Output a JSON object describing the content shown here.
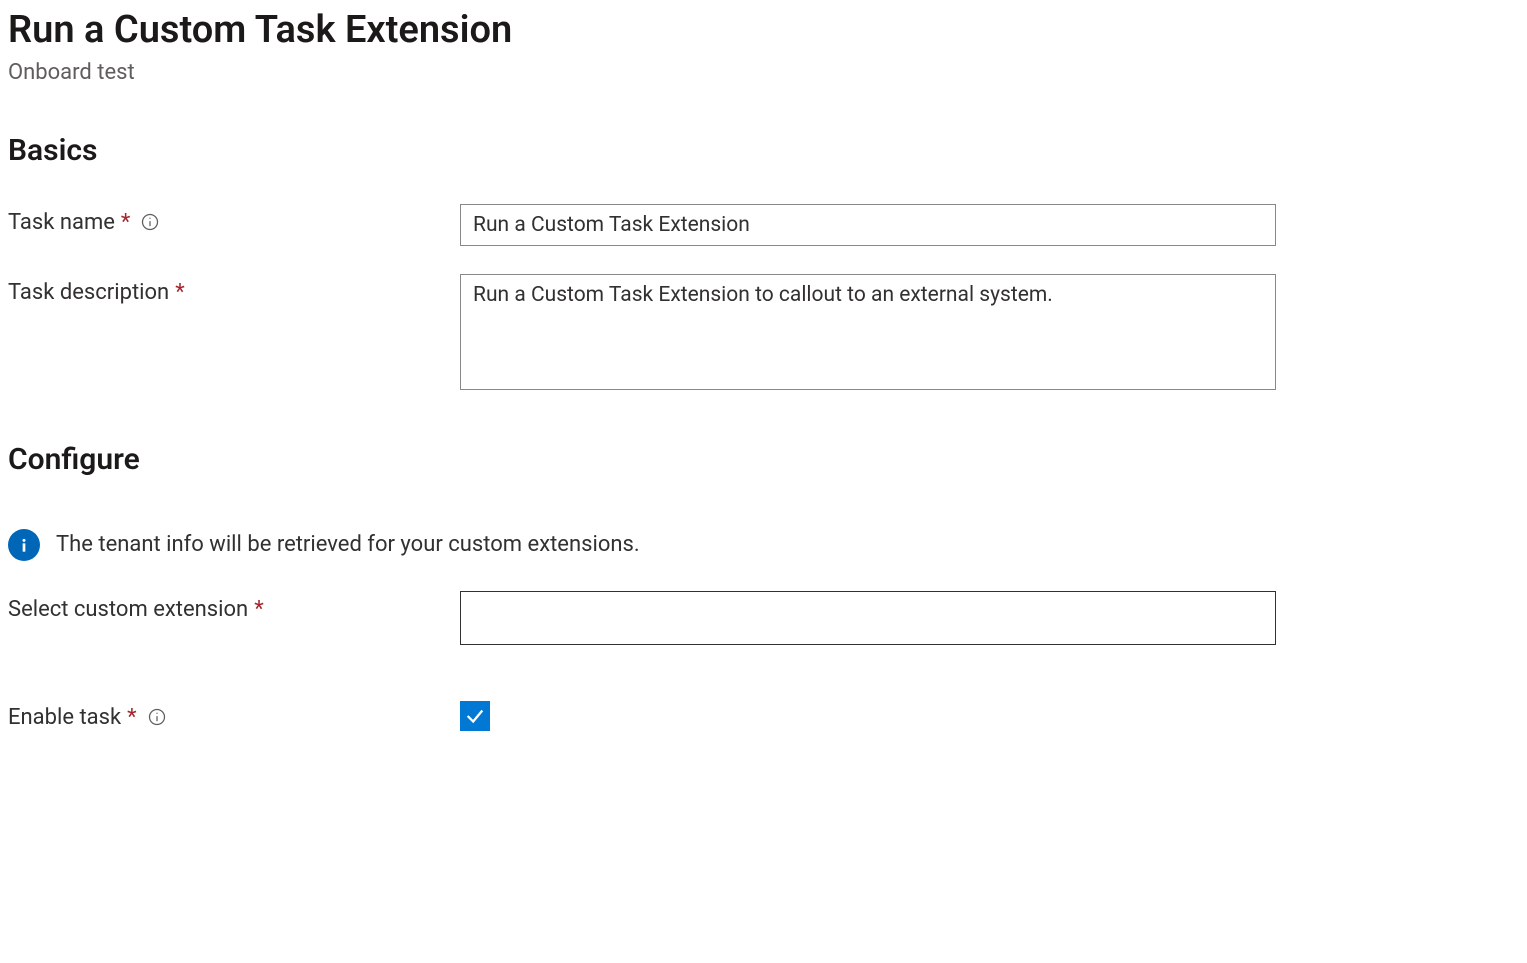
{
  "header": {
    "title": "Run a Custom Task Extension",
    "subtitle": "Onboard test"
  },
  "sections": {
    "basics": {
      "heading": "Basics",
      "task_name_label": "Task name",
      "task_name_value": "Run a Custom Task Extension",
      "task_description_label": "Task description",
      "task_description_value": "Run a Custom Task Extension to callout to an external system."
    },
    "configure": {
      "heading": "Configure",
      "info_text": "The tenant info will be retrieved for your custom extensions.",
      "select_extension_label": "Select custom extension",
      "select_extension_value": "",
      "enable_task_label": "Enable task",
      "enable_task_checked": true
    }
  },
  "symbols": {
    "required": "*"
  }
}
